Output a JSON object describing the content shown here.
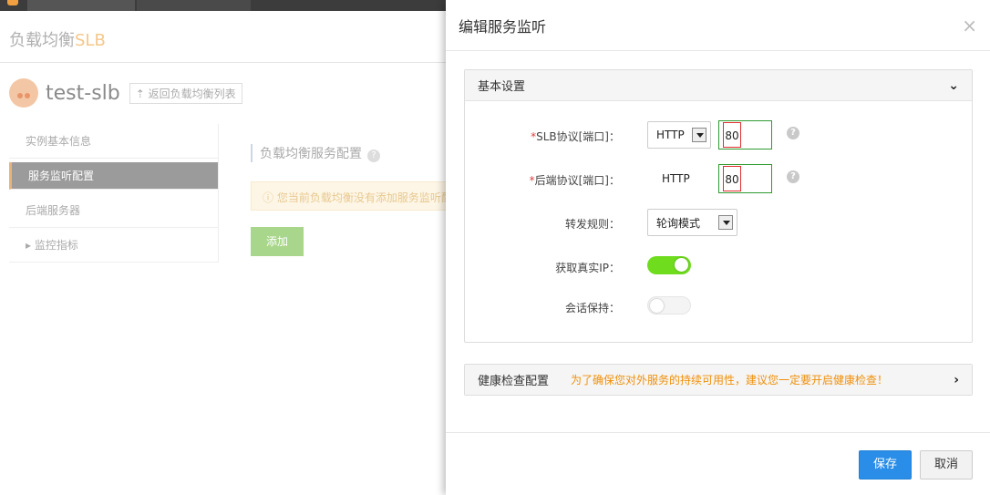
{
  "background": {
    "header_title": "负载均衡",
    "header_accent": "SLB",
    "instance_name": "test-slb",
    "back_link": "返回负载均衡列表",
    "sidebar": [
      "实例基本信息",
      "服务监听配置",
      "后端服务器",
      "监控指标"
    ],
    "section_title": "负载均衡服务配置",
    "warning": "您当前负载均衡没有添加服务监听配",
    "add_button": "添加"
  },
  "modal": {
    "title": "编辑服务监听",
    "close": "×",
    "basic": {
      "title": "基本设置",
      "slb_protocol": {
        "label": "SLB协议[端口]：",
        "required": "*",
        "value": "HTTP",
        "port": "80"
      },
      "backend_protocol": {
        "label": "后端协议[端口]：",
        "required": "*",
        "value": "HTTP",
        "port": "80"
      },
      "forward_rule": {
        "label": "转发规则：",
        "value": "轮询模式"
      },
      "real_ip": {
        "label": "获取真实IP：",
        "enabled": true
      },
      "session": {
        "label": "会话保持：",
        "enabled": false
      }
    },
    "health": {
      "title": "健康检查配置",
      "hint": "为了确保您对外服务的持续可用性，建议您一定要开启健康检查！"
    },
    "footer": {
      "save": "保存",
      "cancel": "取消"
    }
  },
  "colors": {
    "primary": "#2a8ee8",
    "toggle_on": "#6fdc1e",
    "warning_text": "#f0900a",
    "required": "#e04040"
  }
}
